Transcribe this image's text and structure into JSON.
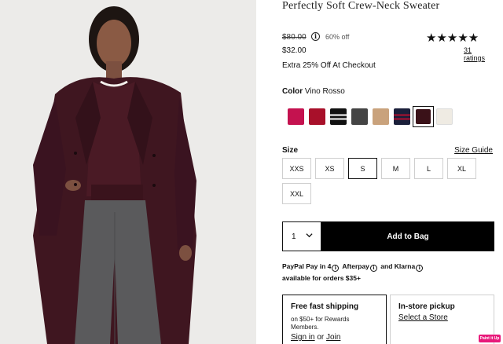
{
  "product": {
    "title": "Perfectly Soft Crew-Neck Sweater",
    "original_price": "$80.00",
    "discount": "60% off",
    "sale_price": "$32.00",
    "promo": "Extra 25% Off At Checkout",
    "rating_stars": "★★★★★",
    "rating_value": 4.7,
    "reviews_label": "31 ratings"
  },
  "color": {
    "label": "Color",
    "selected_name": "Vino Rosso",
    "swatches": [
      {
        "name": "magenta",
        "color": "#c4124f"
      },
      {
        "name": "red",
        "color": "#a8102a"
      },
      {
        "name": "black-white-stripe",
        "color": "#111111"
      },
      {
        "name": "charcoal",
        "color": "#444444"
      },
      {
        "name": "camel",
        "color": "#c9a27c"
      },
      {
        "name": "navy-stripe",
        "color": "#1a1f3a"
      },
      {
        "name": "vino-rosso",
        "color": "#3a1118"
      },
      {
        "name": "ivory",
        "color": "#efebe3"
      }
    ],
    "selected_index": 6
  },
  "size": {
    "label": "Size",
    "guide_label": "Size Guide",
    "options": [
      "XXS",
      "XS",
      "S",
      "M",
      "L",
      "XL",
      "XXL"
    ],
    "selected": "S"
  },
  "purchase": {
    "quantity": "1",
    "add_label": "Add to Bag"
  },
  "payments": {
    "line1_a": "PayPal Pay in 4",
    "line1_b": "Afterpay",
    "line1_c": "and Klarna",
    "line2": "available for orders $35+"
  },
  "fulfillment": {
    "ship_title": "Free fast shipping",
    "ship_sub": "on $50+ for Rewards Members.",
    "signin": "Sign in",
    "or": "or",
    "join": "Join",
    "pickup_title": "In-store pickup",
    "pickup_link": "Select a Store"
  },
  "badge": "Paint it Up",
  "accent": "#000000",
  "badge_color": "#e8197a"
}
